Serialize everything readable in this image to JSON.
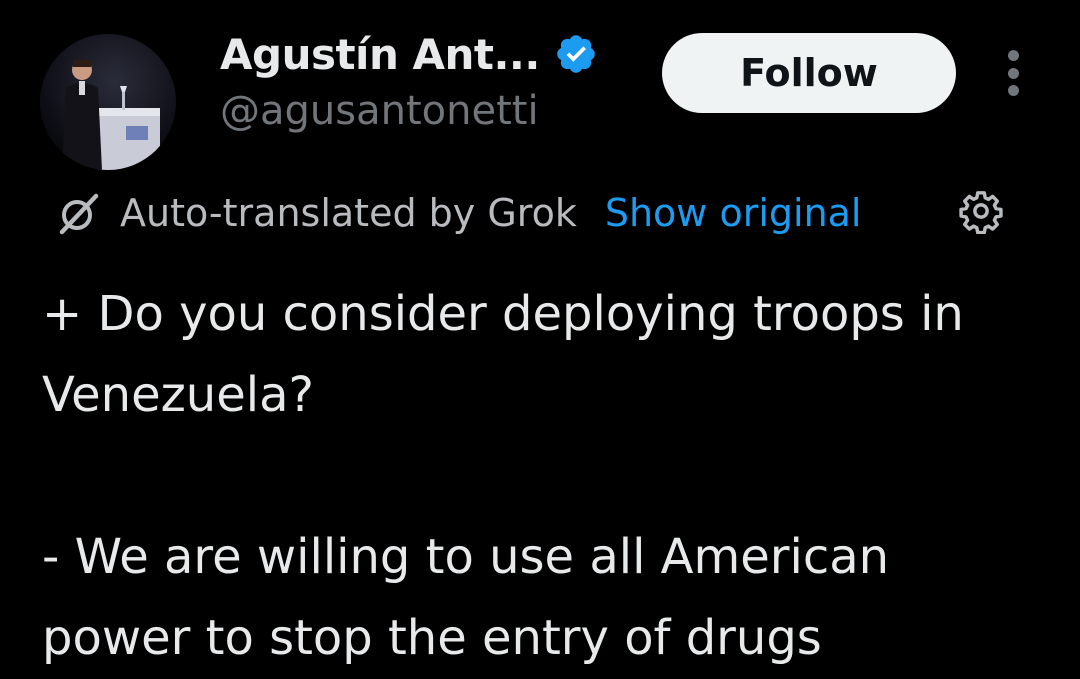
{
  "author": {
    "display_name": "Agustín Ant...",
    "handle": "@agusantonetti",
    "verified": true,
    "avatar": "speaker-at-podium-photo"
  },
  "actions": {
    "follow_label": "Follow",
    "more_icon": "more-vertical-icon"
  },
  "translation": {
    "icon": "grok-icon",
    "label": "Auto-translated by Grok",
    "show_original_label": "Show original",
    "settings_icon": "gear-icon"
  },
  "tweet": {
    "question": "+ Do you consider deploying troops in Venezuela?",
    "answer": "- We are willing to use all American power to stop the entry of drugs"
  },
  "colors": {
    "background": "#000000",
    "primary_text": "#e7e9ea",
    "secondary_text": "#71767b",
    "link": "#1d9bf0",
    "verified_badge": "#1d9bf0",
    "follow_button_bg": "#eff3f4",
    "follow_button_text": "#0f1419"
  }
}
